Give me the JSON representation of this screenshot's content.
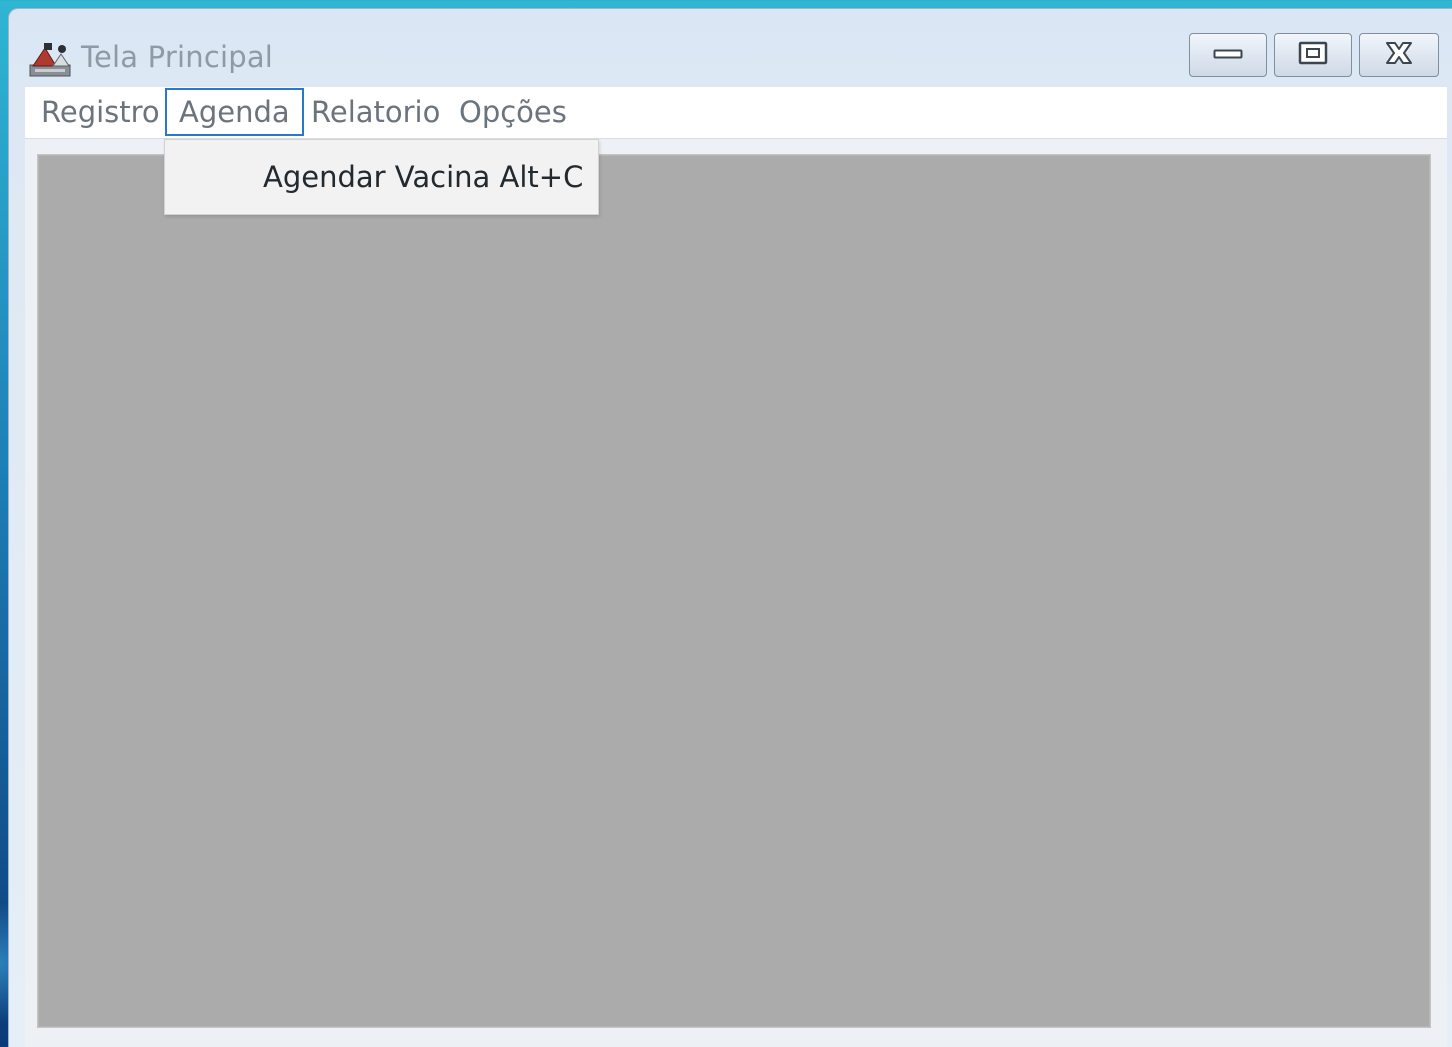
{
  "window": {
    "title": "Tela Principal"
  },
  "menubar": {
    "items": [
      {
        "label": "Registro"
      },
      {
        "label": "Agenda"
      },
      {
        "label": "Relatorio"
      },
      {
        "label": "Opções"
      }
    ],
    "active_item": "Agenda"
  },
  "dropdown": {
    "items": [
      {
        "label": "Agendar Vacina Alt+C"
      }
    ]
  },
  "icons": {
    "app": "app-icon",
    "minimize": "minimize-icon",
    "maximize": "maximize-icon",
    "close": "close-icon"
  },
  "colors": {
    "menu_focus_border": "#2a78c8",
    "desktop_pane": "#ababab",
    "title_text": "#8e9aa6"
  }
}
